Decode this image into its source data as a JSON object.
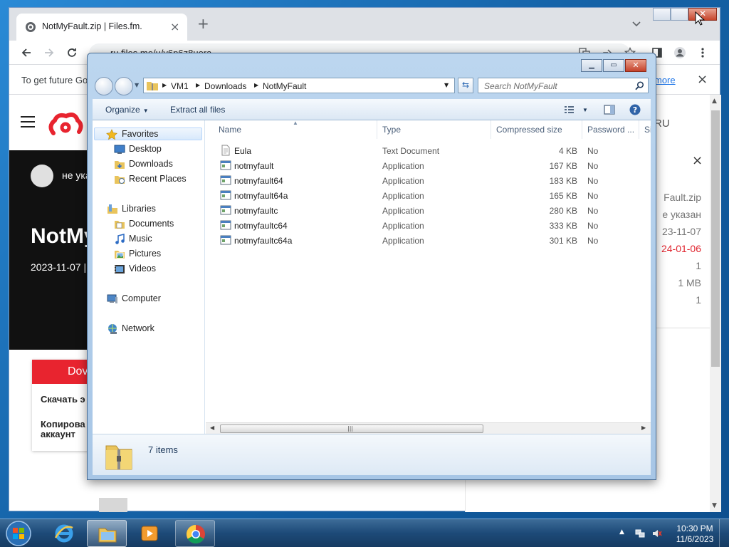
{
  "chrome": {
    "tab_title": "NotMyFault.zip | Files.fm.",
    "tab_close": "×",
    "new_tab": "+",
    "address": "ru.files.me/u/y6p6z8uera",
    "infobar_text": "To get future Go",
    "infobar_link": "more",
    "infobar_close": "×"
  },
  "site": {
    "lang": "RU",
    "user": "не ука",
    "title": "NotMy",
    "date": "2023-11-07  |",
    "download_button": "Dov",
    "link_download": "Скачать э",
    "link_copy": "Копирова аккаунт",
    "side_close": "×",
    "side_values": [
      "Fault.zip",
      "е указан",
      "23-11-07",
      "24-01-06",
      "1",
      "1 MB",
      "1"
    ],
    "accent_color": "#e8242f"
  },
  "explorer": {
    "breadcrumbs": [
      "VM1",
      "Downloads",
      "NotMyFault"
    ],
    "search_placeholder": "Search NotMyFault",
    "commands": {
      "organize": "Organize",
      "extract": "Extract all files"
    },
    "nav": {
      "favorites": "Favorites",
      "desktop": "Desktop",
      "downloads": "Downloads",
      "recent": "Recent Places",
      "libraries": "Libraries",
      "documents": "Documents",
      "music": "Music",
      "pictures": "Pictures",
      "videos": "Videos",
      "computer": "Computer",
      "network": "Network"
    },
    "columns": {
      "name": "Name",
      "type": "Type",
      "size": "Compressed size",
      "password": "Password ...",
      "si": "Si"
    },
    "files": [
      {
        "name": "Eula",
        "type": "Text Document",
        "size": "4 KB",
        "password": "No",
        "icon": "text-document-icon"
      },
      {
        "name": "notmyfault",
        "type": "Application",
        "size": "167 KB",
        "password": "No",
        "icon": "application-icon"
      },
      {
        "name": "notmyfault64",
        "type": "Application",
        "size": "183 KB",
        "password": "No",
        "icon": "application-icon"
      },
      {
        "name": "notmyfault64a",
        "type": "Application",
        "size": "165 KB",
        "password": "No",
        "icon": "application-icon"
      },
      {
        "name": "notmyfaultc",
        "type": "Application",
        "size": "280 KB",
        "password": "No",
        "icon": "application-icon"
      },
      {
        "name": "notmyfaultc64",
        "type": "Application",
        "size": "333 KB",
        "password": "No",
        "icon": "application-icon"
      },
      {
        "name": "notmyfaultc64a",
        "type": "Application",
        "size": "301 KB",
        "password": "No",
        "icon": "application-icon"
      }
    ],
    "item_count": "7 items"
  },
  "taskbar": {
    "time": "10:30 PM",
    "date": "11/6/2023"
  }
}
